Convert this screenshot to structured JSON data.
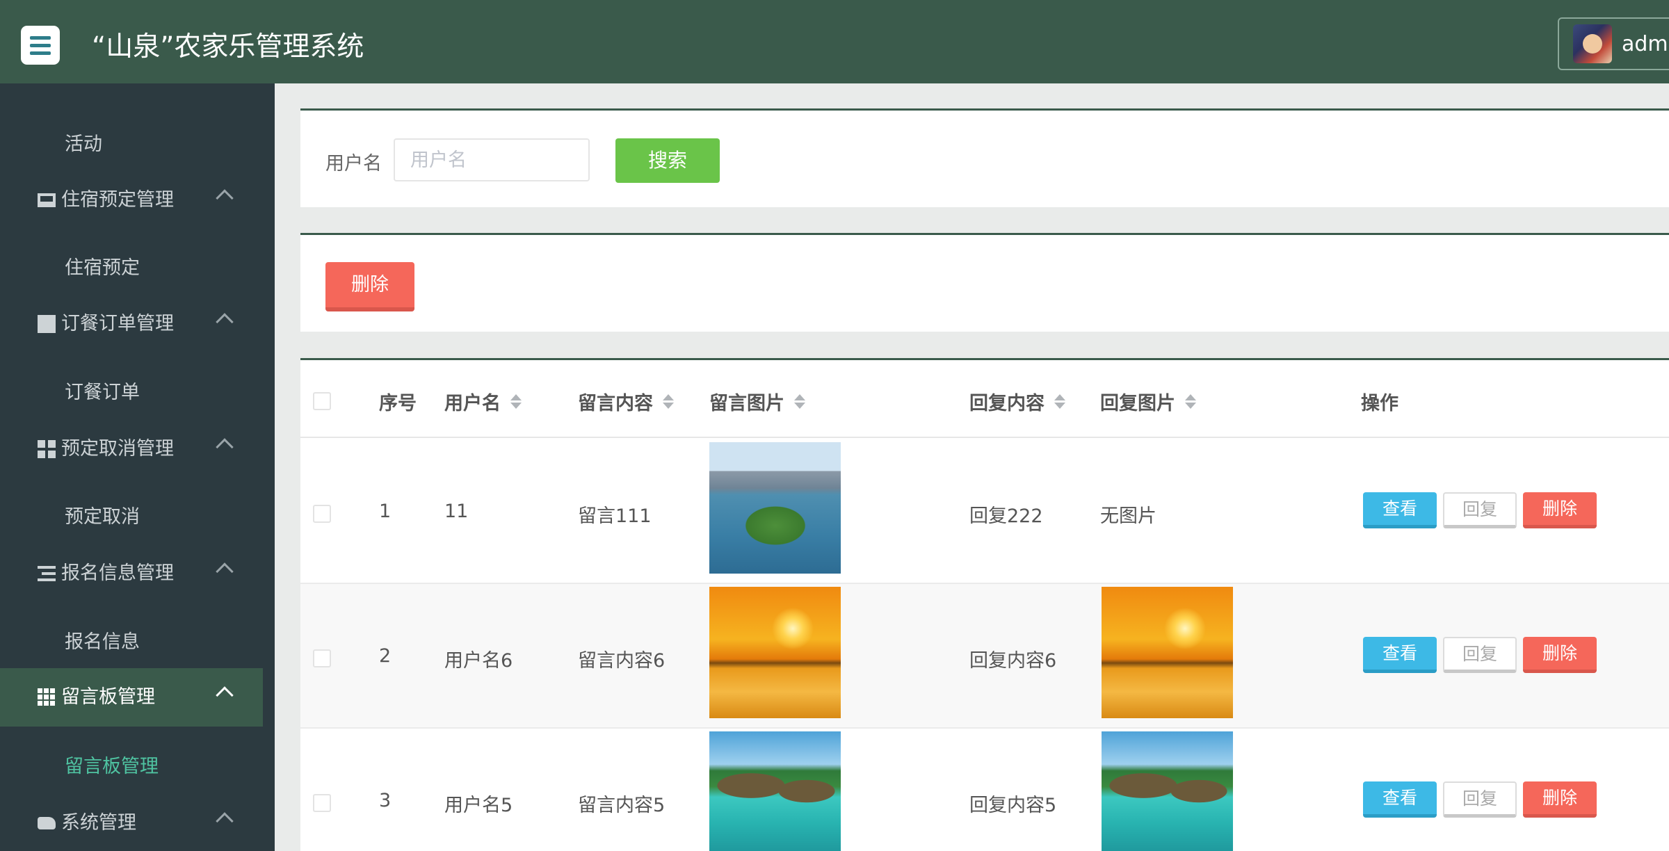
{
  "header": {
    "title": "“山泉”农家乐管理系统",
    "user": "admin"
  },
  "sidebar": {
    "items": [
      {
        "label": "活动",
        "type": "sub"
      },
      {
        "label": "住宿预定管理",
        "type": "group",
        "icon": "monitor-icon"
      },
      {
        "label": "住宿预定",
        "type": "sub"
      },
      {
        "label": "订餐订单管理",
        "type": "group",
        "icon": "book-icon"
      },
      {
        "label": "订餐订单",
        "type": "sub"
      },
      {
        "label": "预定取消管理",
        "type": "group",
        "icon": "grid-icon"
      },
      {
        "label": "预定取消",
        "type": "sub"
      },
      {
        "label": "报名信息管理",
        "type": "group",
        "icon": "list-icon"
      },
      {
        "label": "报名信息",
        "type": "sub"
      },
      {
        "label": "留言板管理",
        "type": "group",
        "icon": "th-icon",
        "active": true
      },
      {
        "label": "留言板管理",
        "type": "sub",
        "active": true
      },
      {
        "label": "系统管理",
        "type": "group",
        "icon": "car-icon"
      }
    ]
  },
  "search": {
    "label": "用户名",
    "placeholder": "用户名",
    "button": "搜索"
  },
  "actions": {
    "delete": "删除"
  },
  "table": {
    "headers": {
      "index": "序号",
      "username": "用户名",
      "content": "留言内容",
      "image": "留言图片",
      "reply": "回复内容",
      "reply_image": "回复图片",
      "ops": "操作"
    },
    "rows": [
      {
        "index": "1",
        "username": "11",
        "content": "留言111",
        "image": "city-lake",
        "reply": "回复222",
        "reply_image_text": "无图片",
        "reply_image": ""
      },
      {
        "index": "2",
        "username": "用户名6",
        "content": "留言内容6",
        "image": "sunset",
        "reply": "回复内容6",
        "reply_image_text": "",
        "reply_image": "sunset"
      },
      {
        "index": "3",
        "username": "用户名5",
        "content": "留言内容5",
        "image": "beach-huts",
        "reply": "回复内容5",
        "reply_image_text": "",
        "reply_image": "beach-huts"
      }
    ],
    "op_labels": {
      "view": "查看",
      "reply": "回复",
      "delete": "删除"
    }
  },
  "colors": {
    "header_bg": "#3a5a4b",
    "sidebar_bg": "#2c3a40",
    "active_sub": "#4fc3a1",
    "search_btn": "#6ac449",
    "delete_btn": "#f5675a",
    "view_btn": "#3db9e6"
  }
}
